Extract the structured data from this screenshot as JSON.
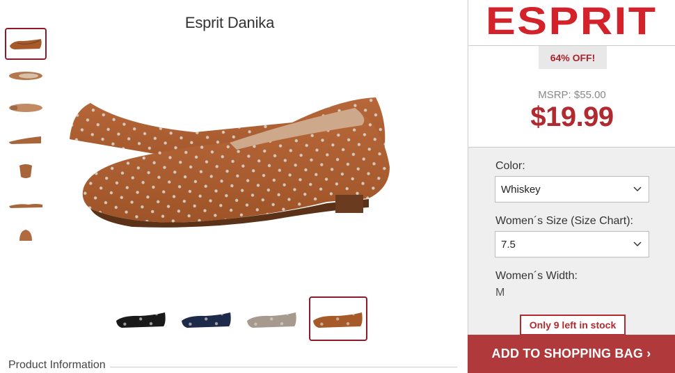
{
  "product": {
    "title": "Esprit Danika"
  },
  "brand": {
    "logo_text": "ESPRIT",
    "color": "#d3222a"
  },
  "thumbnails": [
    "side-view",
    "top-view",
    "sole-view",
    "side-view-2",
    "heel-view",
    "profile-view",
    "front-view"
  ],
  "swatches": [
    {
      "color_name": "black",
      "hex": "#1a1a1a"
    },
    {
      "color_name": "navy",
      "hex": "#1e2a4a"
    },
    {
      "color_name": "grey",
      "hex": "#a69a8e"
    },
    {
      "color_name": "whiskey",
      "hex": "#a65a2a",
      "selected": true
    }
  ],
  "pricing": {
    "discount": "64% OFF!",
    "msrp": "MSRP: $55.00",
    "price": "$19.99"
  },
  "options": {
    "color_label": "Color:",
    "color_value": "Whiskey",
    "size_label": "Women´s Size (Size Chart):",
    "size_value": "7.5",
    "width_label": "Women´s Width:",
    "width_value": "M"
  },
  "stock": "Only 9 left in stock",
  "add_to_bag": "ADD TO SHOPPING BAG ›",
  "section": {
    "product_info": "Product Information"
  },
  "colors": {
    "accent": "#b02a30",
    "button": "#b0393b",
    "selected_border": "#8b1a2b"
  }
}
